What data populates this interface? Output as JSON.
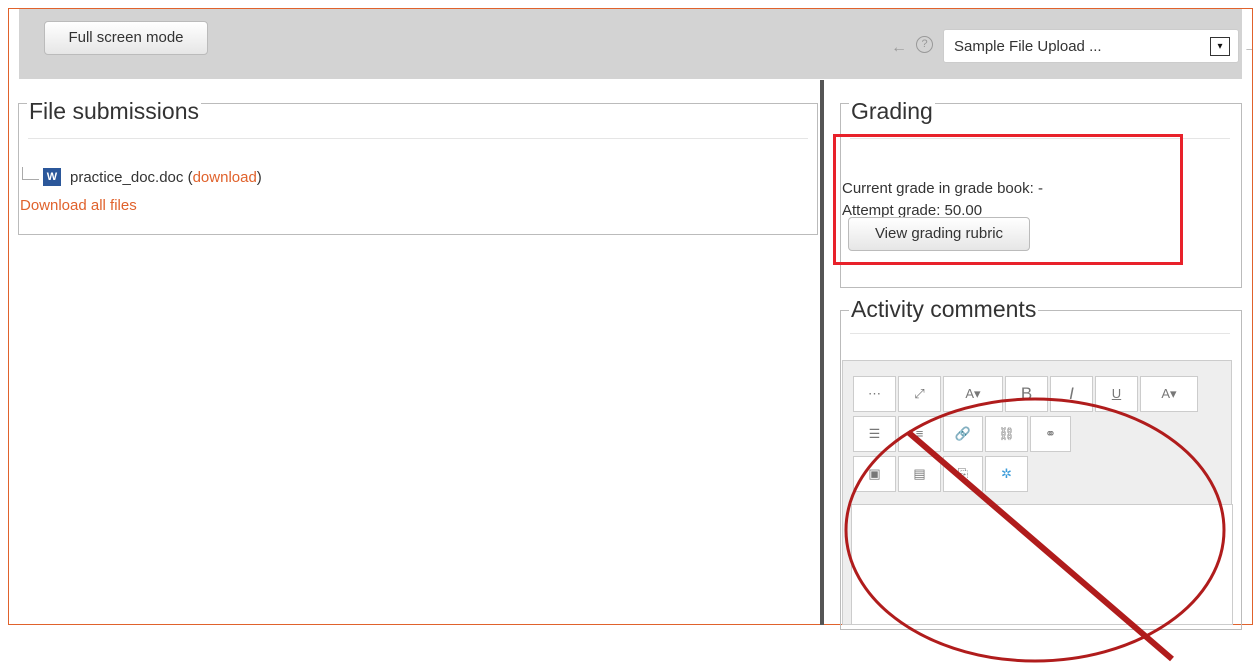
{
  "toolbar": {
    "fullscreen_label": "Full screen mode",
    "prev_icon": "←",
    "help_icon": "?",
    "next_icon": "→",
    "assignment_select": "Sample File Upload ...",
    "caret": "▾"
  },
  "file_submissions": {
    "legend": "File submissions",
    "file_name": "practice_doc.doc",
    "paren_open": " (",
    "download_link": "download",
    "paren_close": ")",
    "download_all": "Download all files",
    "word_icon_letter": "W"
  },
  "grading": {
    "legend": "Grading",
    "current_grade": "Current grade in grade book: -",
    "attempt_grade": "Attempt grade: 50.00",
    "rubric_button": "View grading rubric"
  },
  "comments": {
    "legend": "Activity comments",
    "toolbar_row1": [
      "⋯",
      "⤢",
      "A▾",
      "B",
      "I",
      "U",
      "A▾"
    ],
    "toolbar_row2": [
      "☰",
      "≡",
      "🔗",
      "⛓",
      "⚭"
    ],
    "toolbar_row3": [
      "▣",
      "▤",
      "⎘",
      "✲"
    ]
  },
  "colors": {
    "accent": "#e0622c",
    "highlight": "#e8212a",
    "prohibition": "#b01c1c"
  }
}
